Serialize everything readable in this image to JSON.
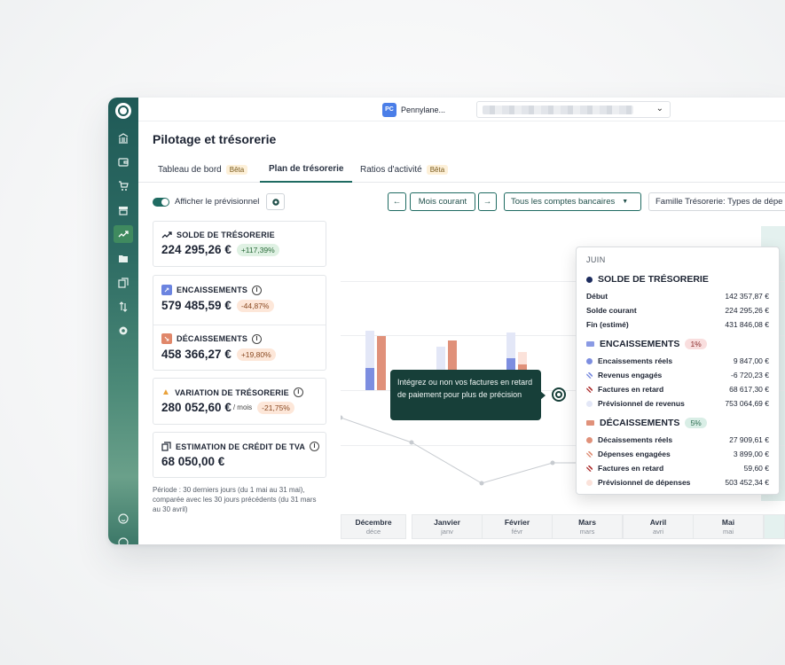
{
  "topbar": {
    "company_initials": "PC",
    "company_name": "Pennylane..."
  },
  "page": {
    "title": "Pilotage et trésorerie"
  },
  "tabs": [
    {
      "label": "Tableau de bord",
      "badge": "Bêta"
    },
    {
      "label": "Plan de trésorerie",
      "badge": ""
    },
    {
      "label": "Ratios d'activité",
      "badge": "Bêta"
    }
  ],
  "toolbar": {
    "toggle_label": "Afficher le prévisionnel",
    "period_label": "Mois courant",
    "accounts_label": "Tous les comptes bancaires",
    "famille_label": "Famille Trésorerie: Types de dépe"
  },
  "cards": {
    "solde": {
      "label": "SOLDE DE TRÉSORERIE",
      "value": "224 295,26 €",
      "delta": "+117,39%"
    },
    "encaissements": {
      "label": "ENCAISSEMENTS",
      "value": "579 485,59 €",
      "delta": "-44,87%"
    },
    "decaissements": {
      "label": "DÉCAISSEMENTS",
      "value": "458 366,27 €",
      "delta": "+19,80%"
    },
    "variation": {
      "label": "VARIATION DE TRÉSORERIE",
      "value": "280 052,60 €",
      "unit": "/ mois",
      "delta": "-21,75%"
    },
    "tva": {
      "label": "ESTIMATION DE CRÉDIT DE TVA",
      "value": "68 050,00 €"
    }
  },
  "note": "Période : 30 derniers jours (du 1 mai au 31 mai), comparée avec les 30 jours précédents (du 31 mars au 30 avril)",
  "axis": [
    {
      "month": "Décembre",
      "short": "déce"
    },
    {
      "month": "Janvier",
      "short": "janv"
    },
    {
      "month": "Février",
      "short": "févr"
    },
    {
      "month": "Mars",
      "short": "mars"
    },
    {
      "month": "Avril",
      "short": "avri"
    },
    {
      "month": "Mai",
      "short": "mai"
    }
  ],
  "tooltip_text": "Intégrez ou non vos factures en retard de paiement pour plus de précision",
  "popup": {
    "month": "JUIN",
    "solde": {
      "title": "SOLDE DE TRÉSORERIE",
      "rows": [
        {
          "label": "Début",
          "value": "142 357,87 €"
        },
        {
          "label": "Solde courant",
          "value": "224 295,26 €"
        },
        {
          "label": "Fin (estimé)",
          "value": "431 846,08 €"
        }
      ]
    },
    "encaissements": {
      "title": "ENCAISSEMENTS",
      "pct": "1%",
      "rows": [
        {
          "label": "Encaissements réels",
          "value": "9 847,00 €"
        },
        {
          "label": "Revenus engagés",
          "value": "-6 720,23 €"
        },
        {
          "label": "Factures en retard",
          "value": "68 617,30 €"
        },
        {
          "label": "Prévisionnel de revenus",
          "value": "753 064,69 €"
        }
      ]
    },
    "decaissements": {
      "title": "DÉCAISSEMENTS",
      "pct": "5%",
      "rows": [
        {
          "label": "Décaissements réels",
          "value": "27 909,61 €"
        },
        {
          "label": "Dépenses engagées",
          "value": "3 899,00 €"
        },
        {
          "label": "Factures en retard",
          "value": "59,60 €"
        },
        {
          "label": "Prévisionnel de dépenses",
          "value": "503 452,34 €"
        }
      ]
    }
  },
  "colors": {
    "brand": "#1f6b62",
    "encaissement": "#7d8ee0",
    "decaissement": "#e0917a"
  }
}
